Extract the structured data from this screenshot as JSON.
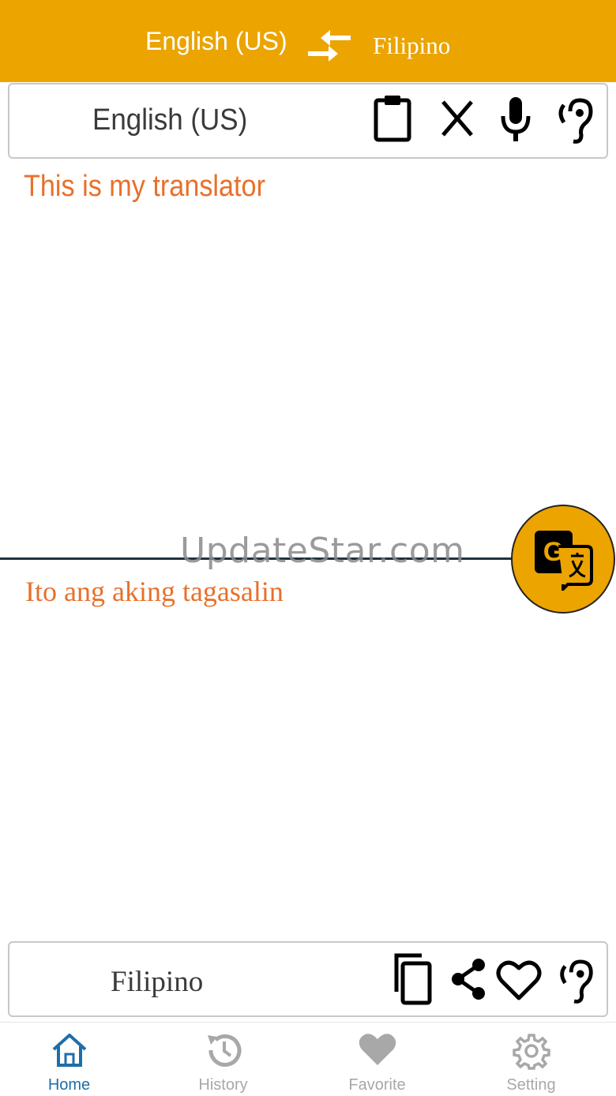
{
  "header": {
    "source_language": "English (US)",
    "target_language": "Filipino",
    "swap_icon": "swap-arrows-icon",
    "background": "#EBA400"
  },
  "input_panel": {
    "language_label": "English (US)",
    "actions": [
      "clipboard-icon",
      "clear-icon",
      "microphone-icon",
      "listen-icon"
    ],
    "text": "This is my translator"
  },
  "watermark": "UpdateStar.com",
  "translate_button": {
    "icon": "google-translate-icon",
    "color": "#EBA400"
  },
  "output_panel": {
    "text": "Ito ang aking tagasalin",
    "language_label": "Filipino",
    "actions": [
      "copy-icon",
      "share-icon",
      "favorite-icon",
      "listen-icon"
    ]
  },
  "text_color": "#E8702A",
  "bottom_nav": {
    "active_color": "#1e6ea8",
    "inactive_color": "#a8a8a8",
    "items": [
      {
        "label": "Home",
        "icon": "home-icon",
        "active": true
      },
      {
        "label": "History",
        "icon": "history-icon",
        "active": false
      },
      {
        "label": "Favorite",
        "icon": "heart-icon",
        "active": false
      },
      {
        "label": "Setting",
        "icon": "gear-icon",
        "active": false
      }
    ]
  }
}
